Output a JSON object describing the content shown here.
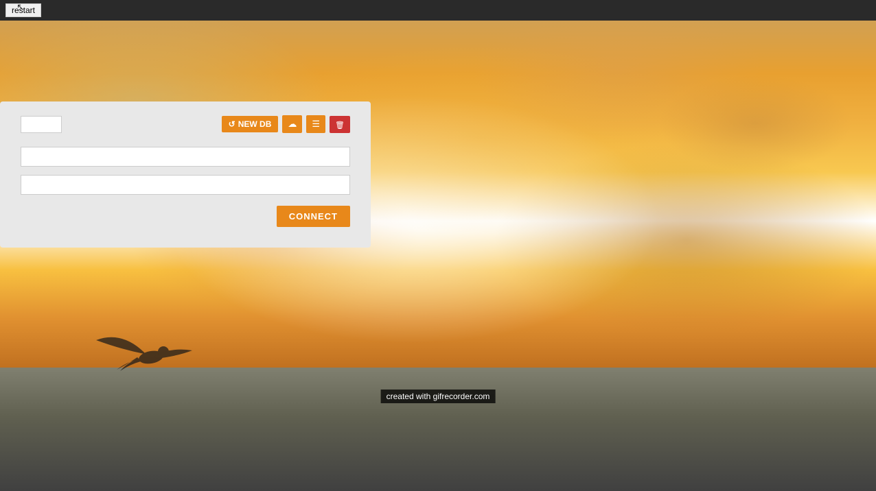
{
  "topbar": {
    "restart_label": "restart"
  },
  "toolbar": {
    "new_db_label": "NEW DB",
    "db_select_options": [
      ""
    ],
    "db_select_value": ""
  },
  "form": {
    "field1_placeholder": "",
    "field1_value": "",
    "field2_placeholder": "",
    "field2_value": ""
  },
  "connect_button": {
    "label": "CONNECT"
  },
  "watermark": {
    "text": "created with gifrecorder.com"
  },
  "colors": {
    "orange": "#e8881a",
    "red": "#cc3333",
    "topbar_bg": "#2a2a2a"
  }
}
